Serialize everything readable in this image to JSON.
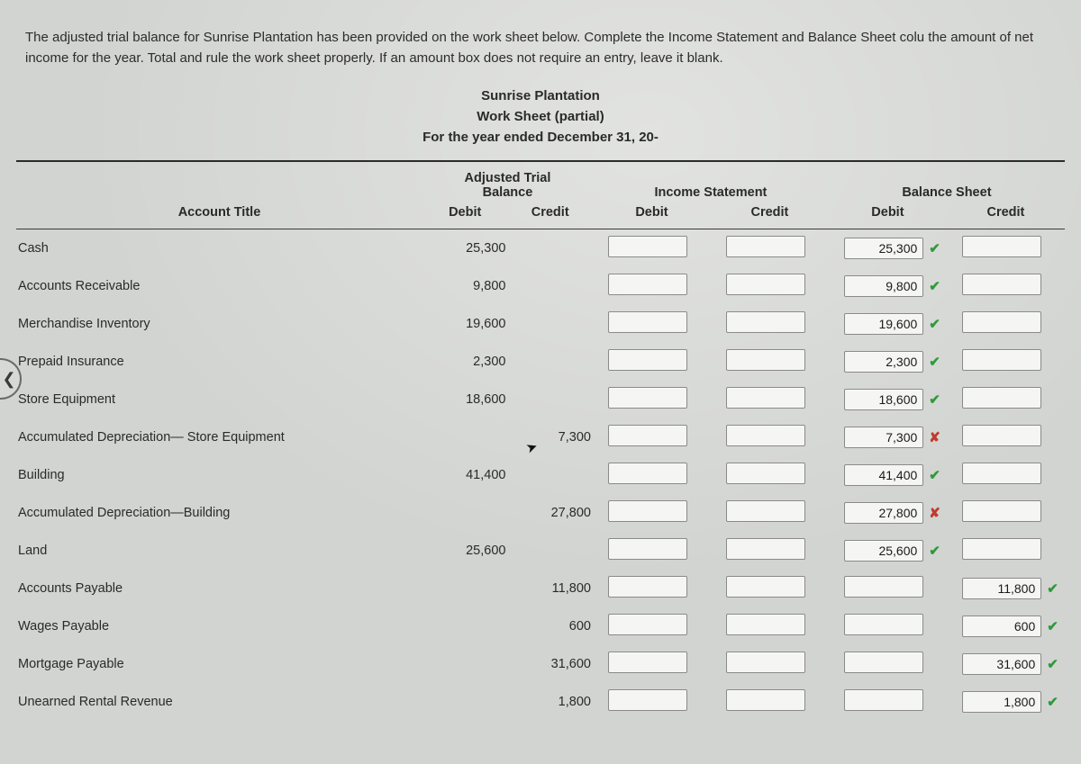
{
  "instructions": "The adjusted trial balance for Sunrise Plantation has been provided on the work sheet below. Complete the Income Statement and Balance Sheet colu the amount of net income for the year. Total and rule the work sheet properly. If an amount box does not require an entry, leave it blank.",
  "title": {
    "line1": "Sunrise Plantation",
    "line2": "Work Sheet (partial)",
    "line3": "For the year ended December 31, 20-"
  },
  "headers": {
    "account_title": "Account Title",
    "adj_group": "Adjusted Trial\nBalance",
    "is_group": "Income Statement",
    "bs_group": "Balance Sheet",
    "debit": "Debit",
    "credit": "Credit"
  },
  "rows": [
    {
      "title": "Cash",
      "adj_debit": "25,300",
      "adj_credit": "",
      "is_debit": "",
      "is_credit": "",
      "bs_debit": "25,300",
      "bs_debit_mark": "check",
      "bs_credit": "",
      "bs_credit_mark": ""
    },
    {
      "title": "Accounts Receivable",
      "adj_debit": "9,800",
      "adj_credit": "",
      "is_debit": "",
      "is_credit": "",
      "bs_debit": "9,800",
      "bs_debit_mark": "check",
      "bs_credit": "",
      "bs_credit_mark": ""
    },
    {
      "title": "Merchandise Inventory",
      "adj_debit": "19,600",
      "adj_credit": "",
      "is_debit": "",
      "is_credit": "",
      "bs_debit": "19,600",
      "bs_debit_mark": "check",
      "bs_credit": "",
      "bs_credit_mark": ""
    },
    {
      "title": "Prepaid Insurance",
      "adj_debit": "2,300",
      "adj_credit": "",
      "is_debit": "",
      "is_credit": "",
      "bs_debit": "2,300",
      "bs_debit_mark": "check",
      "bs_credit": "",
      "bs_credit_mark": ""
    },
    {
      "title": "Store Equipment",
      "adj_debit": "18,600",
      "adj_credit": "",
      "is_debit": "",
      "is_credit": "",
      "bs_debit": "18,600",
      "bs_debit_mark": "check",
      "bs_credit": "",
      "bs_credit_mark": ""
    },
    {
      "title": "Accumulated Depreciation— Store Equipment",
      "adj_debit": "",
      "adj_credit": "7,300",
      "is_debit": "",
      "is_credit": "",
      "bs_debit": "7,300",
      "bs_debit_mark": "cross",
      "bs_credit": "",
      "bs_credit_mark": ""
    },
    {
      "title": "Building",
      "adj_debit": "41,400",
      "adj_credit": "",
      "is_debit": "",
      "is_credit": "",
      "bs_debit": "41,400",
      "bs_debit_mark": "check",
      "bs_credit": "",
      "bs_credit_mark": ""
    },
    {
      "title": "Accumulated Depreciation—Building",
      "adj_debit": "",
      "adj_credit": "27,800",
      "is_debit": "",
      "is_credit": "",
      "bs_debit": "27,800",
      "bs_debit_mark": "cross",
      "bs_credit": "",
      "bs_credit_mark": ""
    },
    {
      "title": "Land",
      "adj_debit": "25,600",
      "adj_credit": "",
      "is_debit": "",
      "is_credit": "",
      "bs_debit": "25,600",
      "bs_debit_mark": "check",
      "bs_credit": "",
      "bs_credit_mark": ""
    },
    {
      "title": "Accounts Payable",
      "adj_debit": "",
      "adj_credit": "11,800",
      "is_debit": "",
      "is_credit": "",
      "bs_debit": "",
      "bs_debit_mark": "",
      "bs_credit": "11,800",
      "bs_credit_mark": "check"
    },
    {
      "title": "Wages Payable",
      "adj_debit": "",
      "adj_credit": "600",
      "is_debit": "",
      "is_credit": "",
      "bs_debit": "",
      "bs_debit_mark": "",
      "bs_credit": "600",
      "bs_credit_mark": "check"
    },
    {
      "title": "Mortgage Payable",
      "adj_debit": "",
      "adj_credit": "31,600",
      "is_debit": "",
      "is_credit": "",
      "bs_debit": "",
      "bs_debit_mark": "",
      "bs_credit": "31,600",
      "bs_credit_mark": "check"
    },
    {
      "title": "Unearned Rental Revenue",
      "adj_debit": "",
      "adj_credit": "1,800",
      "is_debit": "",
      "is_credit": "",
      "bs_debit": "",
      "bs_debit_mark": "",
      "bs_credit": "1,800",
      "bs_credit_mark": "check"
    }
  ]
}
